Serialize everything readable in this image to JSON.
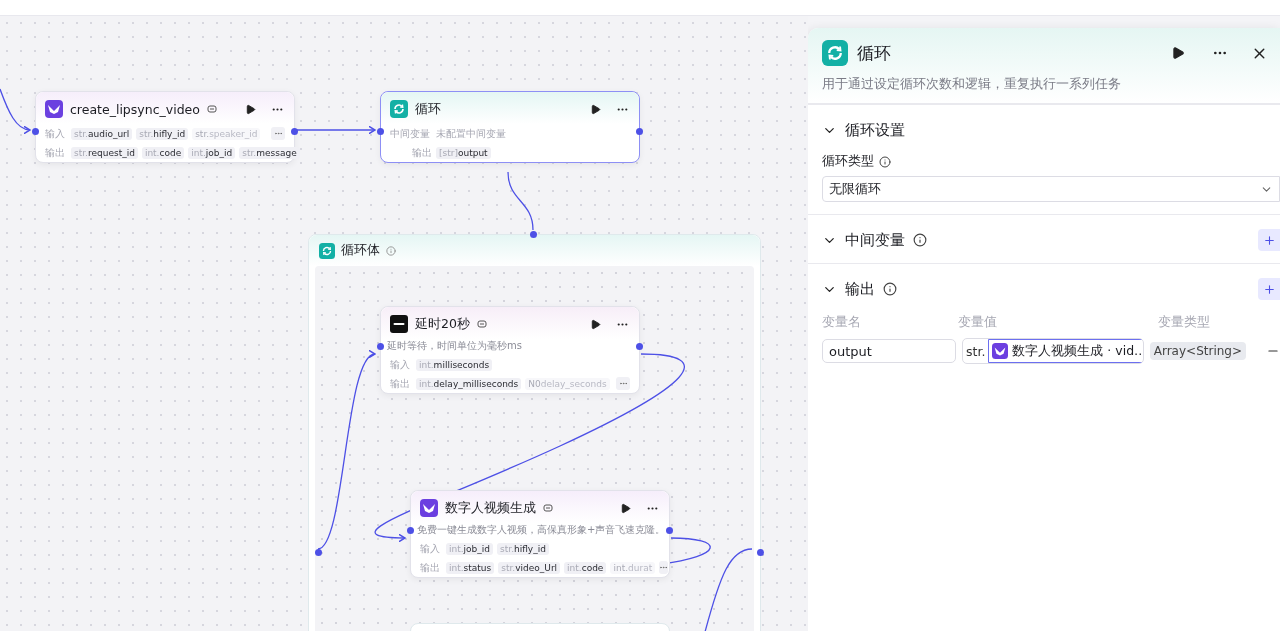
{
  "canvas": {
    "nodes": [
      {
        "kind": "plugin",
        "title": "create_lipsync_video",
        "selected": false,
        "rows": [
          {
            "label": "输入",
            "more": true,
            "params": [
              {
                "type": "str.",
                "name": "audio_url",
                "faded": false
              },
              {
                "type": "str.",
                "name": "hifly_id",
                "faded": false
              },
              {
                "type": "str.",
                "name": "speaker_id",
                "faded": true
              }
            ]
          },
          {
            "label": "输出",
            "more": false,
            "params": [
              {
                "type": "str.",
                "name": "request_id",
                "faded": false
              },
              {
                "type": "int.",
                "name": "code",
                "faded": false
              },
              {
                "type": "int.",
                "name": "job_id",
                "faded": false
              },
              {
                "type": "str.",
                "name": "message",
                "faded": false
              }
            ]
          }
        ]
      },
      {
        "kind": "loop",
        "title": "循环",
        "selected": true,
        "rows": [
          {
            "label": "中间变量",
            "text": "未配置中间变量",
            "more": false
          },
          {
            "label": "输出",
            "more": false,
            "params": [
              {
                "type": "[str]",
                "name": "output",
                "faded": false
              }
            ]
          }
        ]
      }
    ],
    "loop_body": {
      "title": "循环体",
      "nodes": [
        {
          "kind": "delay",
          "title": "延时20秒",
          "selected": false,
          "description": "延时等待，时间单位为毫秒ms",
          "rows": [
            {
              "label": "输入",
              "more": false,
              "params": [
                {
                  "type": "int.",
                  "name": "milliseconds",
                  "faded": false
                }
              ]
            },
            {
              "label": "输出",
              "more": true,
              "params": [
                {
                  "type": "int.",
                  "name": "delay_milliseconds",
                  "faded": false
                },
                {
                  "type": "N0",
                  "name": "delay_seconds",
                  "faded": true
                }
              ]
            }
          ]
        },
        {
          "kind": "plugin",
          "title": "数字人视频生成",
          "selected": false,
          "description": "免费一键生成数字人视频，高保真形象+声音飞速克隆。",
          "rows": [
            {
              "label": "输入",
              "more": false,
              "params": [
                {
                  "type": "int.",
                  "name": "job_id",
                  "faded": false
                },
                {
                  "type": "str.",
                  "name": "hifly_id",
                  "faded": false
                }
              ]
            },
            {
              "label": "输出",
              "more": true,
              "params": [
                {
                  "type": "int.",
                  "name": "status",
                  "faded": false
                },
                {
                  "type": "str.",
                  "name": "video_Url",
                  "faded": false
                },
                {
                  "type": "int.",
                  "name": "code",
                  "faded": false
                },
                {
                  "type": "int.",
                  "name": "durat",
                  "faded": true
                }
              ]
            }
          ]
        }
      ]
    }
  },
  "panel": {
    "title": "循环",
    "description": "用于通过设定循环次数和逻辑，重复执行一系列任务",
    "sections": [
      {
        "title": "循环设置",
        "expanded": true,
        "info": false,
        "add": false,
        "fields": [
          {
            "label": "循环类型",
            "info": true,
            "value": "无限循环"
          }
        ]
      },
      {
        "title": "中间变量",
        "expanded": true,
        "info": true,
        "add": true
      },
      {
        "title": "输出",
        "expanded": true,
        "info": true,
        "add": true,
        "columns": [
          "变量名",
          "变量值",
          "变量类型"
        ],
        "rows": [
          {
            "name": "output",
            "value_type": "str.",
            "value": "数字人视频生成 · vid…",
            "var_type": "Array<String>"
          }
        ]
      }
    ]
  }
}
